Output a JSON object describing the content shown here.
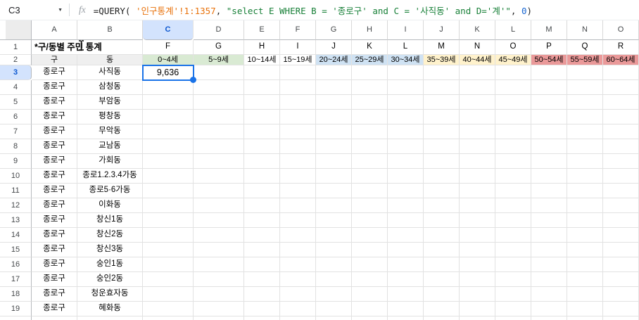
{
  "name_box": {
    "value": "C3"
  },
  "formula_bar": {
    "fx_label": "fx",
    "parts": [
      {
        "text": "=QUERY( ",
        "color": "#222222"
      },
      {
        "text": "'인구통계'!1:1357",
        "color": "#e8710a"
      },
      {
        "text": ", ",
        "color": "#222222"
      },
      {
        "text": "\"select E WHERE B = '종로구' and C = '사직동' and D='계'\"",
        "color": "#188038"
      },
      {
        "text": ", ",
        "color": "#222222"
      },
      {
        "text": "0",
        "color": "#1967d2"
      },
      {
        "text": ")",
        "color": "#222222"
      }
    ]
  },
  "column_headers": [
    "A",
    "B",
    "C",
    "D",
    "E",
    "F",
    "G",
    "H",
    "I",
    "J",
    "K",
    "L",
    "M",
    "N",
    "O"
  ],
  "selection": {
    "column": "C",
    "row": "3",
    "cell": "C3",
    "value": "9,636",
    "accent": "#1a73e8",
    "header_bg": "#d3e3fd",
    "header_text": "#0b57d0"
  },
  "row1": {
    "number": "1",
    "title": "*구/동별 주민 통계",
    "cells": [
      "F",
      "G",
      "H",
      "I",
      "J",
      "K",
      "L",
      "M",
      "N",
      "O",
      "P",
      "Q",
      "R"
    ]
  },
  "row2": {
    "number": "2",
    "cells": [
      {
        "label": "구",
        "bg": "#efefef"
      },
      {
        "label": "동",
        "bg": "#efefef"
      },
      {
        "label": "0~4세",
        "bg": "#d9ead3"
      },
      {
        "label": "5~9세",
        "bg": "#d9ead3"
      },
      {
        "label": "10~14세",
        "bg": "#ffffff"
      },
      {
        "label": "15~19세",
        "bg": "#ffffff"
      },
      {
        "label": "20~24세",
        "bg": "#cfe2f3"
      },
      {
        "label": "25~29세",
        "bg": "#cfe2f3"
      },
      {
        "label": "30~34세",
        "bg": "#cfe2f3"
      },
      {
        "label": "35~39세",
        "bg": "#fff2cc"
      },
      {
        "label": "40~44세",
        "bg": "#fff2cc"
      },
      {
        "label": "45~49세",
        "bg": "#fff2cc"
      },
      {
        "label": "50~54세",
        "bg": "#ea9999"
      },
      {
        "label": "55~59세",
        "bg": "#ea9999"
      },
      {
        "label": "60~64세",
        "bg": "#ea9999"
      }
    ]
  },
  "rows": [
    {
      "number": "3",
      "gu": "종로구",
      "dong": "사직동",
      "value": "9,636"
    },
    {
      "number": "4",
      "gu": "종로구",
      "dong": "삼청동",
      "value": ""
    },
    {
      "number": "5",
      "gu": "종로구",
      "dong": "부암동",
      "value": ""
    },
    {
      "number": "6",
      "gu": "종로구",
      "dong": "평창동",
      "value": ""
    },
    {
      "number": "7",
      "gu": "종로구",
      "dong": "무악동",
      "value": ""
    },
    {
      "number": "8",
      "gu": "종로구",
      "dong": "교남동",
      "value": ""
    },
    {
      "number": "9",
      "gu": "종로구",
      "dong": "가회동",
      "value": ""
    },
    {
      "number": "10",
      "gu": "종로구",
      "dong": "종로1.2.3.4가동",
      "value": ""
    },
    {
      "number": "11",
      "gu": "종로구",
      "dong": "종로5·6가동",
      "value": ""
    },
    {
      "number": "12",
      "gu": "종로구",
      "dong": "이화동",
      "value": ""
    },
    {
      "number": "13",
      "gu": "종로구",
      "dong": "창신1동",
      "value": ""
    },
    {
      "number": "14",
      "gu": "종로구",
      "dong": "창신2동",
      "value": ""
    },
    {
      "number": "15",
      "gu": "종로구",
      "dong": "창신3동",
      "value": ""
    },
    {
      "number": "16",
      "gu": "종로구",
      "dong": "숭인1동",
      "value": ""
    },
    {
      "number": "17",
      "gu": "종로구",
      "dong": "숭인2동",
      "value": ""
    },
    {
      "number": "18",
      "gu": "종로구",
      "dong": "청운효자동",
      "value": ""
    },
    {
      "number": "19",
      "gu": "종로구",
      "dong": "혜화동",
      "value": ""
    }
  ]
}
